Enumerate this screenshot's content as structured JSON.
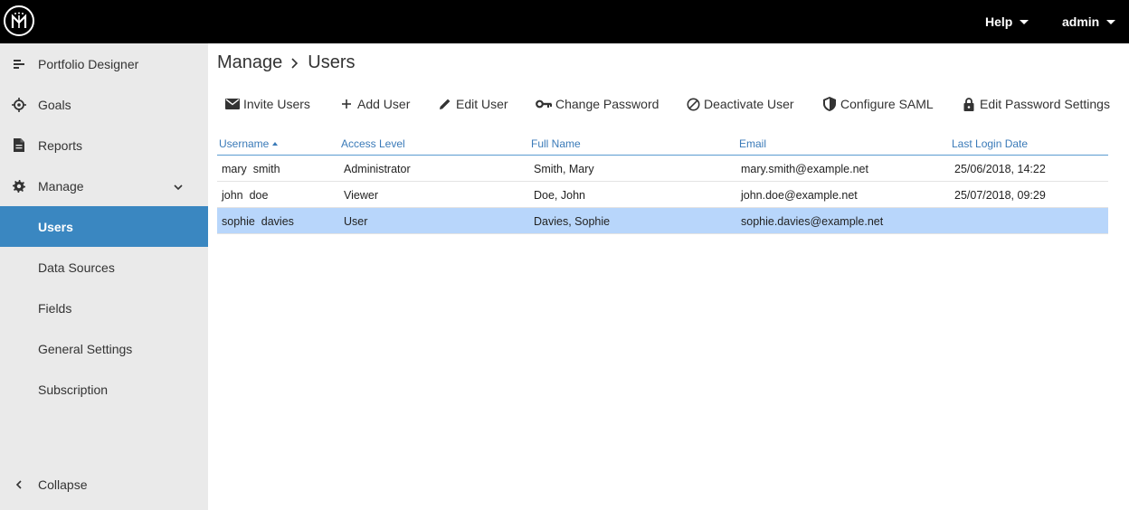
{
  "header": {
    "help_label": "Help",
    "user_label": "admin"
  },
  "sidebar": {
    "items": [
      {
        "label": "Portfolio Designer",
        "icon": "portfolio-designer-icon"
      },
      {
        "label": "Goals",
        "icon": "target-icon"
      },
      {
        "label": "Reports",
        "icon": "document-icon"
      },
      {
        "label": "Manage",
        "icon": "gear-icon"
      },
      {
        "label": "Users",
        "active": true
      },
      {
        "label": "Data Sources"
      },
      {
        "label": "Fields"
      },
      {
        "label": "General Settings"
      },
      {
        "label": "Subscription"
      }
    ],
    "collapse_label": "Collapse"
  },
  "breadcrumb": {
    "parent": "Manage",
    "current": "Users"
  },
  "toolbar": {
    "buttons": [
      {
        "label": "Invite Users",
        "icon": "envelope-icon"
      },
      {
        "label": "Add User",
        "icon": "plus-icon"
      },
      {
        "label": "Edit User",
        "icon": "pencil-icon"
      },
      {
        "label": "Change Password",
        "icon": "key-icon"
      },
      {
        "label": "Deactivate User",
        "icon": "block-icon"
      },
      {
        "label": "Configure SAML",
        "icon": "shield-icon"
      },
      {
        "label": "Edit Password Settings",
        "icon": "lock-icon"
      }
    ]
  },
  "table": {
    "columns": [
      "Username",
      "Access Level",
      "Full Name",
      "Email",
      "Last Login Date"
    ],
    "sort_column": "Username",
    "sort_direction": "ascending",
    "rows": [
      {
        "username": "mary  smith",
        "access": "Administrator",
        "name": "Smith, Mary",
        "email": "mary.smith@example.net",
        "last_login": "25/06/2018, 14:22"
      },
      {
        "username": "john  doe",
        "access": "Viewer",
        "name": "Doe, John",
        "email": "john.doe@example.net",
        "last_login": "25/07/2018, 09:29"
      },
      {
        "username": "sophie  davies",
        "access": "User",
        "name": "Davies, Sophie",
        "email": "sophie.davies@example.net",
        "last_login": "",
        "selected": true
      }
    ]
  },
  "colors": {
    "topbar": "#000000",
    "sidebar_bg": "#eaeaea",
    "active_nav": "#3a87c1",
    "header_text": "#3a7ab8",
    "selected_row": "#b8d6fb"
  }
}
